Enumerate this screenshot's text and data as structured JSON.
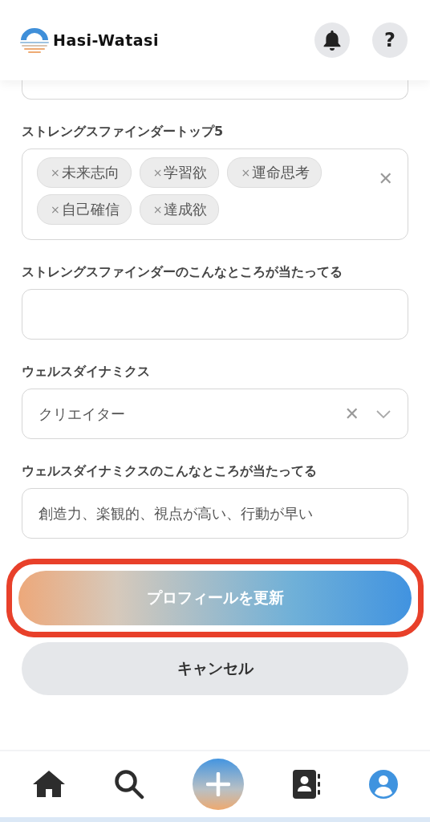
{
  "header": {
    "title": "Hasi-Watasi",
    "help_label": "?"
  },
  "form": {
    "fields": [
      {
        "kind": "tags",
        "label": "ストレングスファインダートップ5",
        "tags": [
          "未来志向",
          "学習欲",
          "運命思考",
          "自己確信",
          "達成欲"
        ],
        "tag_remove": "×",
        "clear": "✕"
      },
      {
        "kind": "text",
        "label": "ストレングスファインダーのこんなところが当たってる"
      },
      {
        "kind": "select",
        "label": "ウェルスダイナミクス",
        "value": "クリエイター",
        "clear": "✕"
      },
      {
        "kind": "text",
        "label": "ウェルスダイナミクスのこんなところが当たってる",
        "value": "創造力、楽観的、視点が高い、行動が早い"
      }
    ],
    "submit": {
      "label": "プロフィールを更新",
      "highlighted": true
    },
    "cancel": {
      "label": "キャンセル"
    }
  },
  "bottom_nav": [
    {
      "kind": "home",
      "selected": false
    },
    {
      "kind": "search",
      "selected": false
    },
    {
      "kind": "add",
      "selected": false
    },
    {
      "kind": "contacts",
      "selected": false
    },
    {
      "kind": "profile",
      "selected": true
    }
  ]
}
